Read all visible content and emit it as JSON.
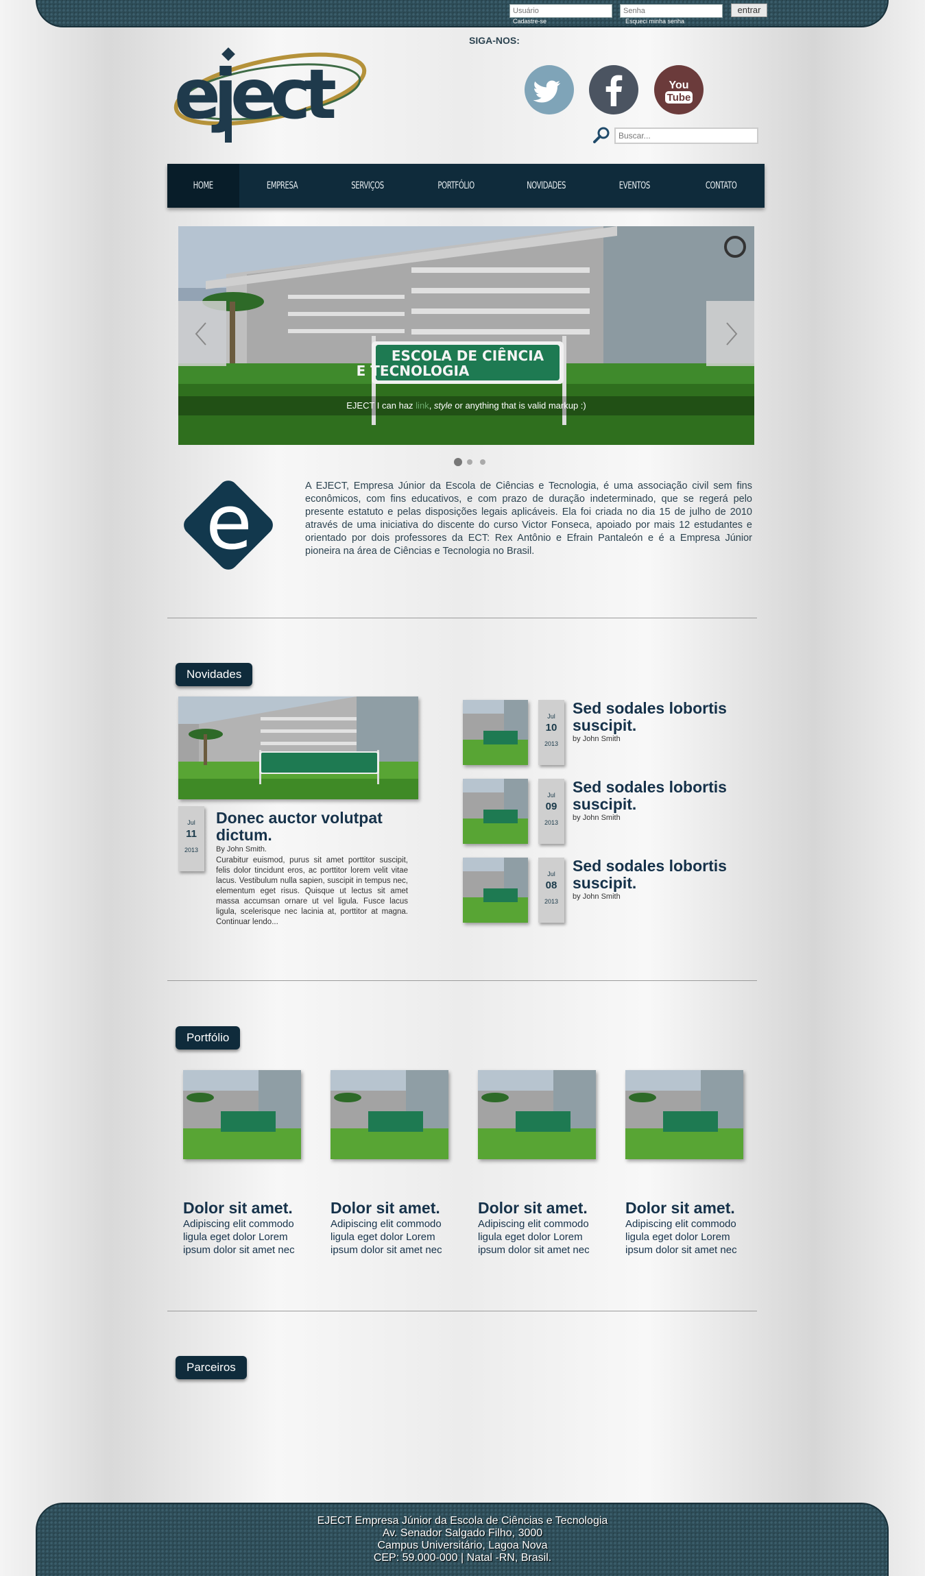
{
  "topbar": {
    "user_placeholder": "Usuário",
    "pass_placeholder": "Senha",
    "register_link": "Cadastre-se",
    "forgot_link": "Esqueci minha senha",
    "login_button": "entrar"
  },
  "header": {
    "follow_label": "SIGA-NOS:",
    "social": [
      "twitter-icon",
      "facebook-icon",
      "youtube-icon"
    ],
    "youtube_top": "You",
    "youtube_bottom": "Tube",
    "search_placeholder": "Buscar..."
  },
  "nav": {
    "items": [
      "HOME",
      "EMPRESA",
      "SERVIÇOS",
      "PORTFÓLIO",
      "NOVIDADES",
      "EVENTOS",
      "CONTATO"
    ]
  },
  "slider": {
    "sign_line1": "ESCOLA DE CIÊNCIA",
    "sign_line2": "E TECNOLOGIA",
    "caption_pre": "EJECT I can haz ",
    "caption_link": "link",
    "caption_mid": ", ",
    "caption_em": "style",
    "caption_post": " or anything that is valid markup :)"
  },
  "about": {
    "logo_letter": "e",
    "text": "A EJECT, Empresa Júnior da Escola de Ciências e Tecnologia, é uma associação civil sem fins econômicos, com fins educativos, e com prazo de duração indeterminado, que se regerá pelo presente estatuto e pelas disposições legais aplicáveis. Ela foi criada no dia 15 de julho de 2010 através de uma iniciativa do discente do curso Victor Fonseca, apoiado por mais 12 estudantes e orientado por dois professores da ECT: Rex Antônio e Efrain Pantaleón e é a Empresa Júnior pioneira na área de Ciências e Tecnologia no Brasil."
  },
  "novidades": {
    "title": "Novidades",
    "featured": {
      "month": "Jul",
      "day": "11",
      "year": "2013",
      "title": "Donec auctor volutpat dictum.",
      "by_prefix": "By ",
      "author": "John Smith.",
      "body": "Curabitur euismod, purus sit amet porttitor suscipit, felis dolor tincidunt eros, ac porttitor lorem velit vitae lacus. Vestibulum nulla sapien, suscipit in tempus nec, elementum eget risus. Quisque ut lectus sit amet massa accumsan ornare ut vel ligula. Fusce lacus ligula, scelerisque nec lacinia at, porttitor at magna. Continuar lendo..."
    },
    "items": [
      {
        "month": "Jul",
        "day": "10",
        "year": "2013",
        "title": "Sed sodales lobortis suscipit.",
        "by_prefix": "by ",
        "author": "John Smith"
      },
      {
        "month": "Jul",
        "day": "09",
        "year": "2013",
        "title": "Sed sodales lobortis suscipit.",
        "by_prefix": "by ",
        "author": "John Smith"
      },
      {
        "month": "Jul",
        "day": "08",
        "year": "2013",
        "title": "Sed sodales lobortis suscipit.",
        "by_prefix": "by ",
        "author": "John Smith"
      }
    ]
  },
  "portfolio": {
    "title": "Portfólio",
    "items": [
      {
        "title": "Dolor sit amet.",
        "desc": "Adipiscing elit commodo ligula eget dolor Lorem ipsum dolor sit amet nec"
      },
      {
        "title": "Dolor sit amet.",
        "desc": "Adipiscing elit commodo ligula eget dolor Lorem ipsum dolor sit amet nec"
      },
      {
        "title": "Dolor sit amet.",
        "desc": "Adipiscing elit commodo ligula eget dolor Lorem ipsum dolor sit amet nec"
      },
      {
        "title": "Dolor sit amet.",
        "desc": "Adipiscing elit commodo ligula eget dolor Lorem ipsum dolor sit amet nec"
      }
    ]
  },
  "parceiros": {
    "title": "Parceiros"
  },
  "footer": {
    "line1": "EJECT Empresa Júnior da Escola de Ciências e Tecnologia",
    "line2": "Av. Senador Salgado Filho, 3000",
    "line3": "Campus Universitário, Lagoa Nova",
    "line4": "CEP: 59.000-000 | Natal -RN, Brasil."
  }
}
